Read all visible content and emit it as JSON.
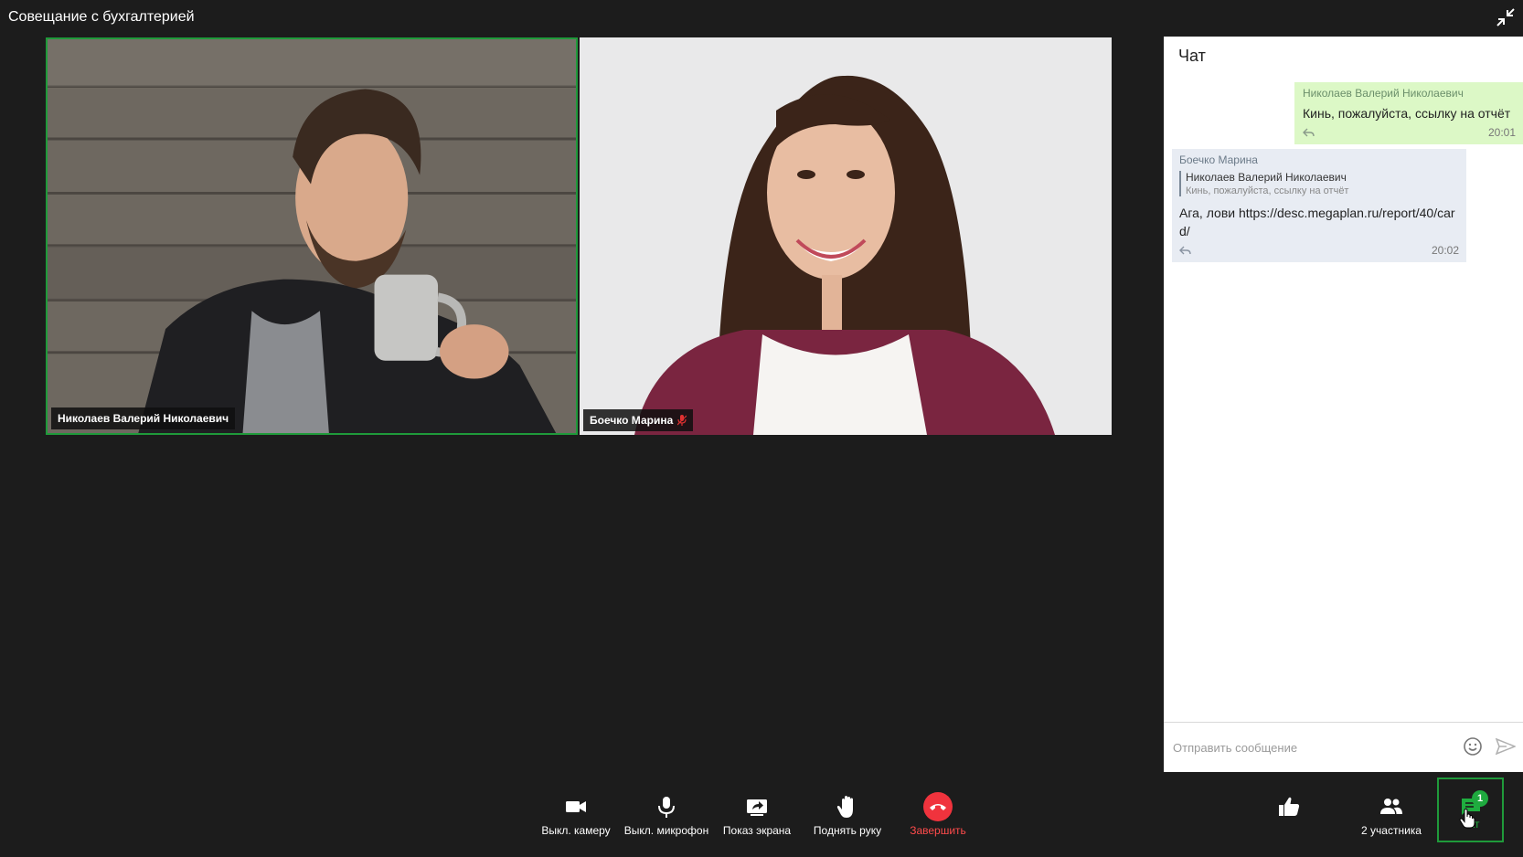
{
  "window": {
    "title": "Совещание с бухгалтерией"
  },
  "participants": [
    {
      "name": "Николаев Валерий Николаевич",
      "active_speaker": true,
      "muted": false
    },
    {
      "name": "Боечко Марина",
      "active_speaker": false,
      "muted": true
    }
  ],
  "chat": {
    "title": "Чат",
    "messages": [
      {
        "author": "Николаев Валерий Николаевич",
        "text": "Кинь, пожалуйста, ссылку на отчёт",
        "time": "20:01",
        "own": true
      },
      {
        "author": "Боечко Марина",
        "quote_author": "Николаев Валерий Николаевич",
        "quote_text": "Кинь, пожалуйста, ссылку на отчёт",
        "text": "Ага, лови https://desc.megaplan.ru/report/40/card/",
        "time": "20:02",
        "own": false
      }
    ],
    "input_placeholder": "Отправить сообщение",
    "input_value": ""
  },
  "toolbar": {
    "camera_label": "Выкл. камеру",
    "mic_label": "Выкл. микрофон",
    "screen_label": "Показ экрана",
    "hand_label": "Поднять руку",
    "end_label": "Завершить",
    "participants_label": "2 участника",
    "chat_label": "Чат",
    "chat_badge": "1"
  },
  "colors": {
    "background": "#1c1c1c",
    "accent_green": "#1f9a3a",
    "end_red": "#f0333d",
    "own_bubble": "#dcf8c6",
    "other_bubble": "#e8ecf3"
  },
  "icons": {
    "collapse": "collapse-icon",
    "camera": "video-camera-icon",
    "mic": "microphone-icon",
    "screen": "screen-share-icon",
    "hand": "raise-hand-icon",
    "end": "hang-up-icon",
    "like": "thumbs-up-icon",
    "participants": "people-icon",
    "chat": "chat-icon"
  }
}
